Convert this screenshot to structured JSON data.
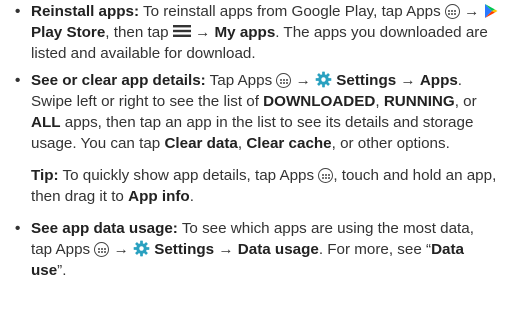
{
  "items": [
    {
      "title": "Reinstall apps:",
      "t1": " To reinstall apps from Google Play, tap Apps ",
      "t2": " → ",
      "t3": " ",
      "play_store": "Play Store",
      "t4": ", then tap ",
      "t5": " → ",
      "my_apps": "My apps",
      "t6": ". The apps you downloaded are listed and available for download."
    },
    {
      "title": "See or clear app details:",
      "t1": " Tap Apps ",
      "t2": " → ",
      "t3": " ",
      "settings": "Settings",
      "t4": " → ",
      "apps": "Apps",
      "t5": ". Swipe left or right to see the list of ",
      "downloaded": "DOWNLOADED",
      "t6": ", ",
      "running": "RUNNING",
      "t7": ", or ",
      "all": "ALL",
      "t8": " apps, then tap an app in the list to see its details and storage usage. You can tap ",
      "clear_data": "Clear data",
      "t9": ", ",
      "clear_cache": "Clear cache",
      "t10": ", or other options."
    },
    {
      "title": "See app data usage:",
      "t1": " To see which apps are using the most data, tap Apps ",
      "t2": " → ",
      "t3": " ",
      "settings": "Settings",
      "t4": " → ",
      "data_usage": "Data usage",
      "t5": ". For more, see “",
      "data_use": "Data use",
      "t6": "”."
    }
  ],
  "tip": {
    "label": "Tip:",
    "t1": " To quickly show app details, tap Apps ",
    "t2": ", touch and hold an app, then drag it to ",
    "app_info": "App info",
    "t3": "."
  },
  "bullet": "•",
  "icons": {
    "apps": "apps-icon",
    "play_store": "play-store-icon",
    "settings": "settings-gear-icon",
    "menu": "menu-icon"
  },
  "colors": {
    "text": "#333333",
    "gear": "#2aa1c0",
    "play_green": "#00c853",
    "play_blue": "#2979ff",
    "play_red": "#ff3d00",
    "play_yellow": "#ffc400"
  }
}
